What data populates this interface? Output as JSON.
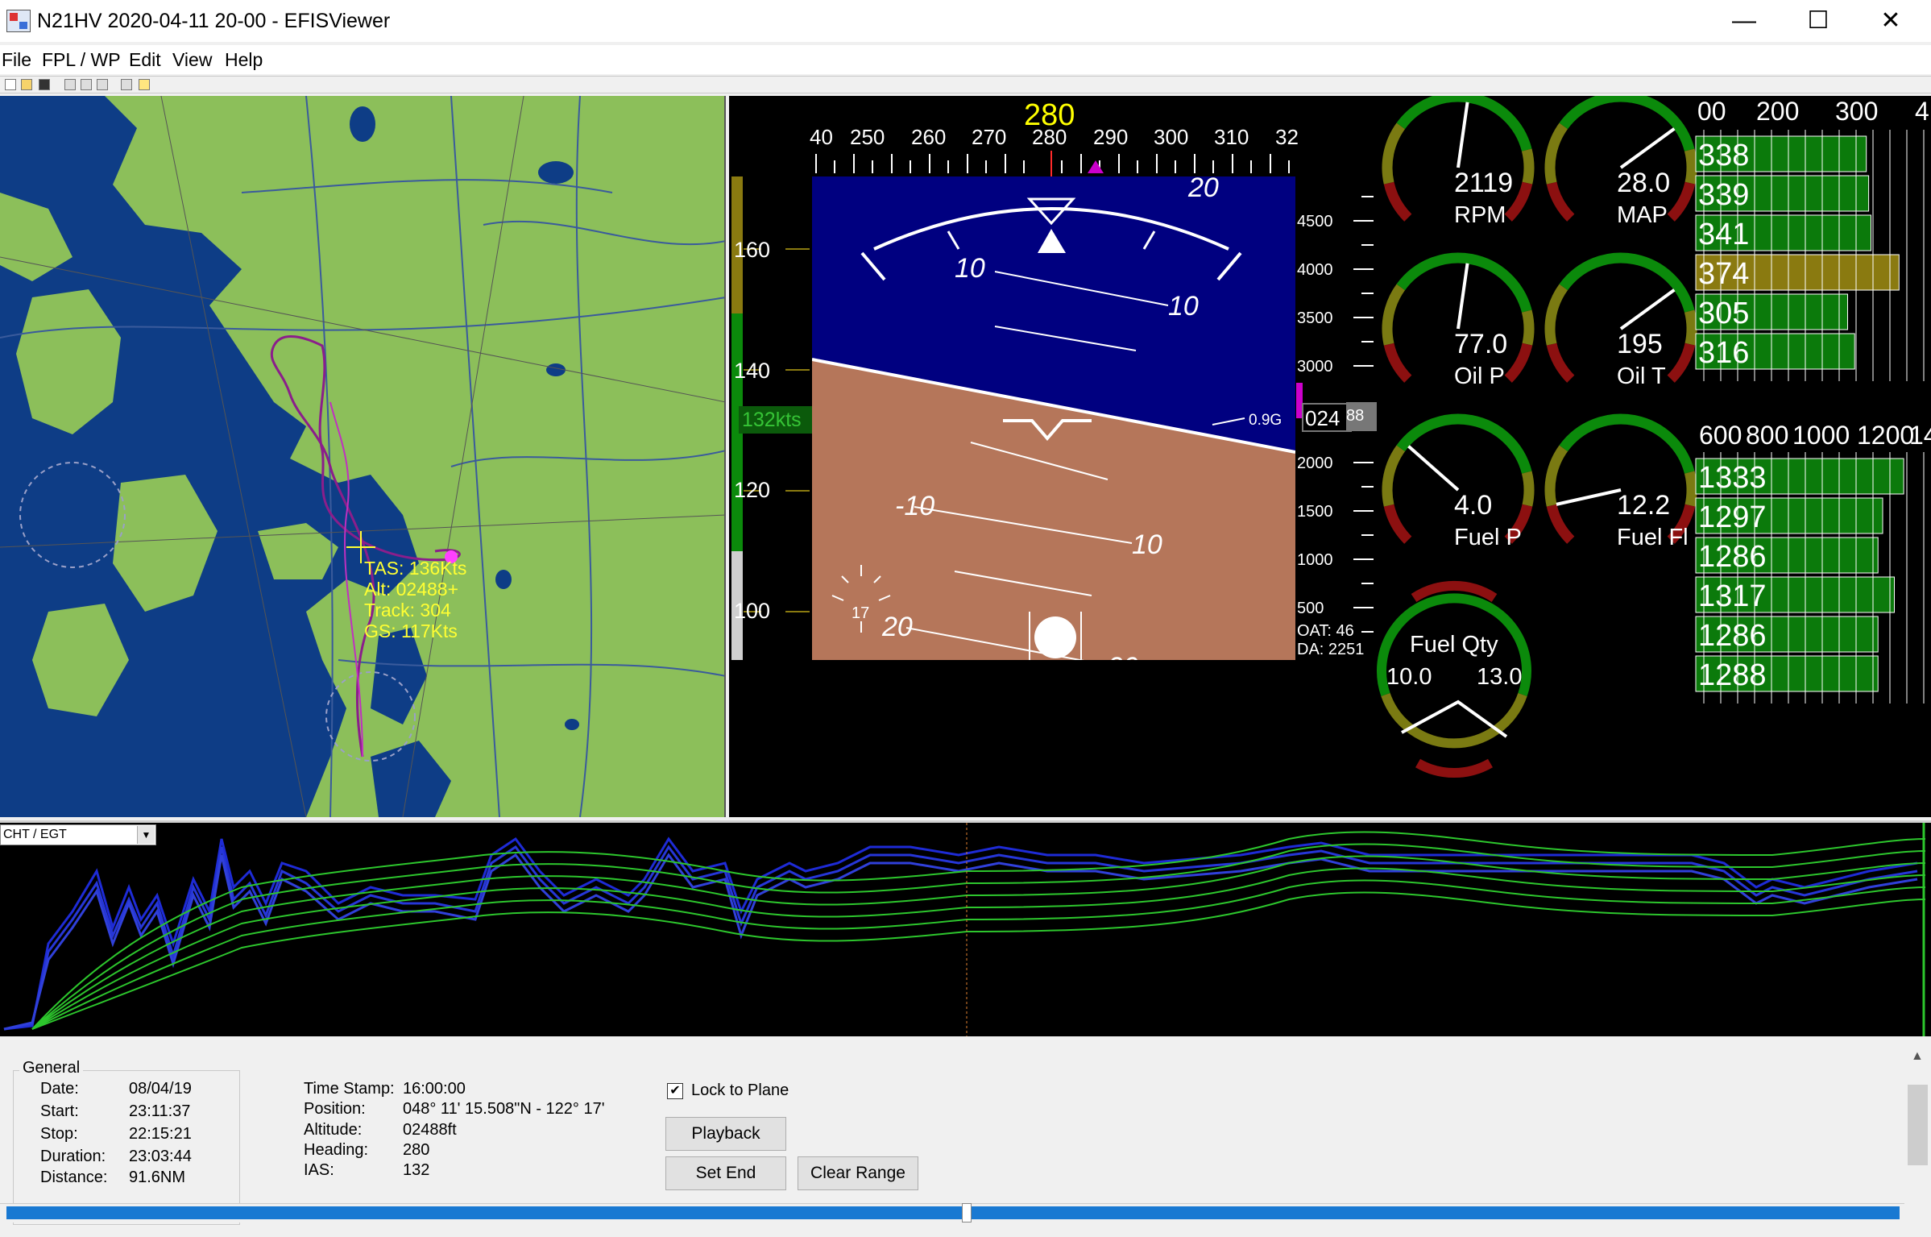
{
  "window": {
    "title": "N21HV 2020-04-11 20-00 - EFISViewer",
    "minimize_icon": "minimize-icon",
    "maximize_icon": "maximize-icon",
    "close_icon": "close-icon",
    "min_glyph": "—",
    "max_glyph": "☐",
    "close_glyph": "✕"
  },
  "menu": [
    "File",
    "FPL / WP",
    "Edit",
    "View",
    "Help"
  ],
  "toolbar_icons": [
    "new-file-icon",
    "open-folder-icon",
    "save-icon",
    "cut-icon",
    "copy-icon",
    "paste-icon",
    "print-icon",
    "help-icon"
  ],
  "map": {
    "labels": {
      "tas": "TAS: 136Kts",
      "alt": "Alt: 02488+",
      "track": "Track: 304",
      "gs": "GS: 117Kts"
    },
    "colors": {
      "land": "#8cbf5a",
      "water": "#0e3d86",
      "track": "#8b1e8b",
      "text": "#ffff33"
    }
  },
  "pfd": {
    "heading_value": "280",
    "heading_ticks": [
      "40",
      "250",
      "260",
      "270",
      "280",
      "290",
      "300",
      "310",
      "32"
    ],
    "pitch_labels": [
      "20",
      "10",
      "10",
      "-10",
      "10",
      "20",
      "20"
    ],
    "speed_ticks": [
      "160",
      "140",
      "120",
      "100"
    ],
    "speed_readout": "132kts",
    "alt_ticks": [
      "4500",
      "4000",
      "3500",
      "3000",
      "2000",
      "1500",
      "1000",
      "500"
    ],
    "alt_readout": "024",
    "alt_readout_small": "88",
    "g_load": "0.9G",
    "oat": "OAT: 46",
    "da": "DA: 2251",
    "wind_value": "17",
    "colors": {
      "sky": "#000080",
      "ground": "#b5765a",
      "speed_text": "#36c436",
      "heading_text": "#ffff00"
    }
  },
  "gauges": [
    {
      "id": "rpm",
      "value": "2119",
      "label": "RPM",
      "fraction": 0.53
    },
    {
      "id": "map",
      "value": "28.0",
      "label": "MAP",
      "fraction": 0.7
    },
    {
      "id": "oilp",
      "value": "77.0",
      "label": "Oil P",
      "fraction": 0.53
    },
    {
      "id": "oilt",
      "value": "195",
      "label": "Oil T",
      "fraction": 0.7
    },
    {
      "id": "fuelp",
      "value": "4.0",
      "label": "Fuel P",
      "fraction": 0.32
    },
    {
      "id": "fuelfl",
      "value": "12.2",
      "label": "Fuel Fl",
      "fraction": 0.12
    }
  ],
  "fuel_qty": {
    "label": "Fuel Qty",
    "left": "10.0",
    "right": "13.0"
  },
  "cht": {
    "scale": [
      "00",
      "200",
      "300",
      "4"
    ],
    "values": [
      "338",
      "339",
      "341",
      "374",
      "305",
      "316"
    ],
    "fractions": [
      0.73,
      0.74,
      0.75,
      0.87,
      0.65,
      0.68
    ],
    "highlight_index": 3
  },
  "egt": {
    "scale": [
      "600",
      "800",
      "1000",
      "1200",
      "14"
    ],
    "values": [
      "1333",
      "1297",
      "1286",
      "1317",
      "1286",
      "1288"
    ],
    "fractions": [
      0.89,
      0.8,
      0.78,
      0.85,
      0.78,
      0.78
    ]
  },
  "chart": {
    "selector": "CHT / EGT",
    "dropdown_icon": "chevron-down-icon"
  },
  "info": {
    "group_title": "General",
    "date_label": "Date:",
    "date_value": "08/04/19",
    "start_label": "Start:",
    "start_value": "23:11:37",
    "stop_label": "Stop:",
    "stop_value": "22:15:21",
    "duration_label": "Duration:",
    "duration_value": "23:03:44",
    "distance_label": "Distance:",
    "distance_value": "91.6NM",
    "timestamp_label": "Time Stamp:",
    "timestamp_value": "16:00:00",
    "position_label": "Position:",
    "position_value": "048° 11' 15.508\"N - 122° 17'",
    "altitude_label": "Altitude:",
    "altitude_value": "02488ft",
    "heading_label": "Heading:",
    "heading_value": "280",
    "ias_label": "IAS:",
    "ias_value": "132",
    "lock_label": "Lock to Plane",
    "lock_checked": "✔",
    "playback_label": "Playback",
    "set_end_label": "Set End",
    "clear_range_label": "Clear Range",
    "progress_fraction": 0.5
  }
}
